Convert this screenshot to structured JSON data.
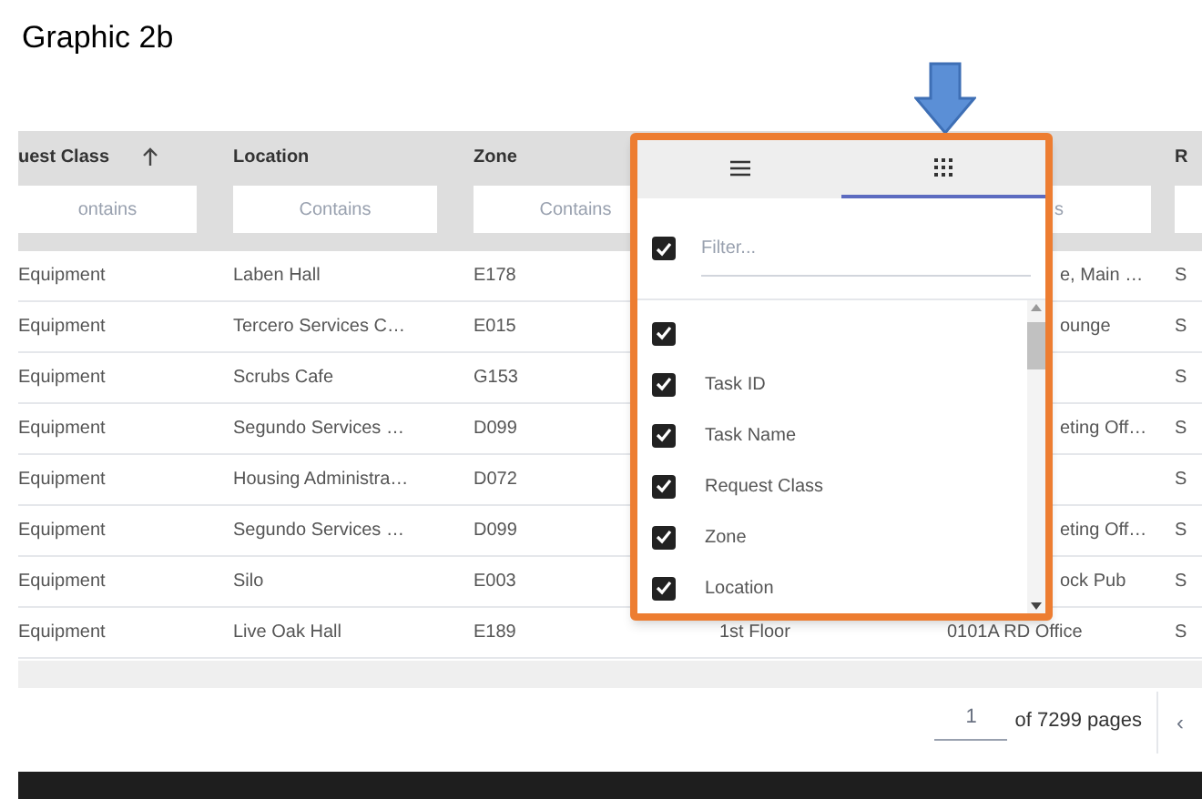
{
  "caption": "Graphic 2b",
  "table": {
    "columns": [
      {
        "label": "uest Class",
        "sorted_ascending": true,
        "filter": "ontains"
      },
      {
        "label": "Location",
        "filter": "Contains"
      },
      {
        "label": "Zone",
        "filter": "Contains"
      },
      {},
      {
        "filter": "s"
      },
      {
        "label": "R",
        "filter_box": true
      }
    ],
    "rows": [
      {
        "cells": [
          "Equipment",
          "Laben Hall",
          "E178",
          null,
          "e, Main …",
          "S"
        ]
      },
      {
        "cells": [
          "Equipment",
          "Tercero Services C…",
          "E015",
          null,
          "ounge",
          "S"
        ]
      },
      {
        "cells": [
          "Equipment",
          "Scrubs Cafe",
          "G153",
          null,
          null,
          "S"
        ]
      },
      {
        "cells": [
          "Equipment",
          "Segundo Services …",
          "D099",
          null,
          "eting Off…",
          "S"
        ]
      },
      {
        "cells": [
          "Equipment",
          "Housing Administra…",
          "D072",
          null,
          null,
          "S"
        ]
      },
      {
        "cells": [
          "Equipment",
          "Segundo Services …",
          "D099",
          null,
          "eting Off…",
          "S"
        ]
      },
      {
        "cells": [
          "Equipment",
          "Silo",
          "E003",
          null,
          "ock Pub",
          "S"
        ]
      },
      {
        "cells": [
          "Equipment",
          "Live Oak Hall",
          "E189",
          "1st Floor",
          "0101A RD Office",
          "S"
        ]
      }
    ]
  },
  "pagination": {
    "page": "1",
    "of_pages": "of 7299 pages",
    "prev": "‹"
  },
  "column_menu": {
    "tabs": [
      {
        "kind": "menu",
        "selected": false
      },
      {
        "kind": "columns",
        "selected": true
      }
    ],
    "select_all": {
      "checked": true
    },
    "filter_placeholder": "Filter...",
    "items": [
      {
        "checked": true
      },
      {
        "label": "Task ID",
        "checked": true
      },
      {
        "label": "Task Name",
        "checked": true
      },
      {
        "label": "Request Class",
        "checked": true
      },
      {
        "label": "Zone",
        "checked": true
      },
      {
        "label": "Location",
        "checked": true
      }
    ]
  }
}
